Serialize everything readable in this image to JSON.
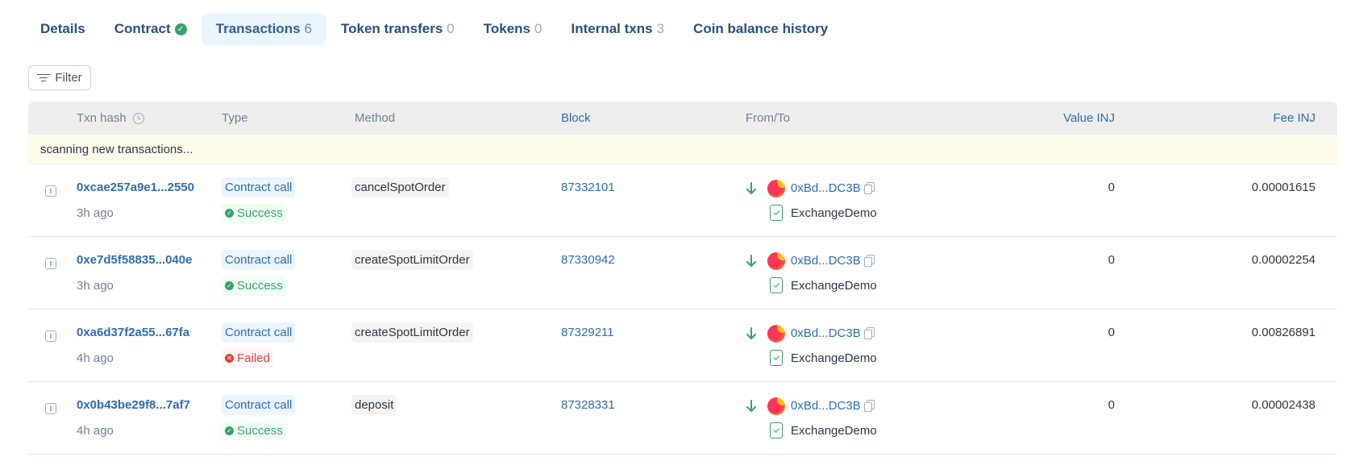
{
  "tabs": [
    {
      "label": "Details",
      "count": ""
    },
    {
      "label": "Contract",
      "count": ""
    },
    {
      "label": "Transactions",
      "count": "6"
    },
    {
      "label": "Token transfers",
      "count": "0"
    },
    {
      "label": "Tokens",
      "count": "0"
    },
    {
      "label": "Internal txns",
      "count": "3"
    },
    {
      "label": "Coin balance history",
      "count": ""
    }
  ],
  "active_tab": "Transactions",
  "filter_label": "Filter",
  "table": {
    "headers": {
      "txn_hash": "Txn hash",
      "type": "Type",
      "method": "Method",
      "block": "Block",
      "from_to": "From/To",
      "value": "Value INJ",
      "fee": "Fee INJ"
    },
    "scanning_text": "scanning new transactions...",
    "rows": [
      {
        "hash": "0xcae257a9e1...2550",
        "time": "3h ago",
        "type": "Contract call",
        "status": "Success",
        "method": "cancelSpotOrder",
        "block": "87332101",
        "from": "0xBd...DC3B",
        "to": "ExchangeDemo",
        "value": "0",
        "fee": "0.00001615"
      },
      {
        "hash": "0xe7d5f58835...040e",
        "time": "3h ago",
        "type": "Contract call",
        "status": "Success",
        "method": "createSpotLimitOrder",
        "block": "87330942",
        "from": "0xBd...DC3B",
        "to": "ExchangeDemo",
        "value": "0",
        "fee": "0.00002254"
      },
      {
        "hash": "0xa6d37f2a55...67fa",
        "time": "4h ago",
        "type": "Contract call",
        "status": "Failed",
        "method": "createSpotLimitOrder",
        "block": "87329211",
        "from": "0xBd...DC3B",
        "to": "ExchangeDemo",
        "value": "0",
        "fee": "0.00826891"
      },
      {
        "hash": "0x0b43be29f8...7af7",
        "time": "4h ago",
        "type": "Contract call",
        "status": "Success",
        "method": "deposit",
        "block": "87328331",
        "from": "0xBd...DC3B",
        "to": "ExchangeDemo",
        "value": "0",
        "fee": "0.00002438"
      }
    ]
  },
  "icons": {
    "verified": "check-circle-icon",
    "filter": "filter-lines-icon",
    "clock": "clock-icon",
    "row_info": "info-square-icon",
    "direction": "arrow-down-icon",
    "avatar": "address-avatar",
    "copy": "copy-icon",
    "contract": "contract-file-icon"
  },
  "colors": {
    "link": "#2f6cb0",
    "success": "#38a169",
    "failed": "#e53e3e",
    "active_tab_bg": "#ebf5fd",
    "scanning_bg": "#fffbeb"
  }
}
